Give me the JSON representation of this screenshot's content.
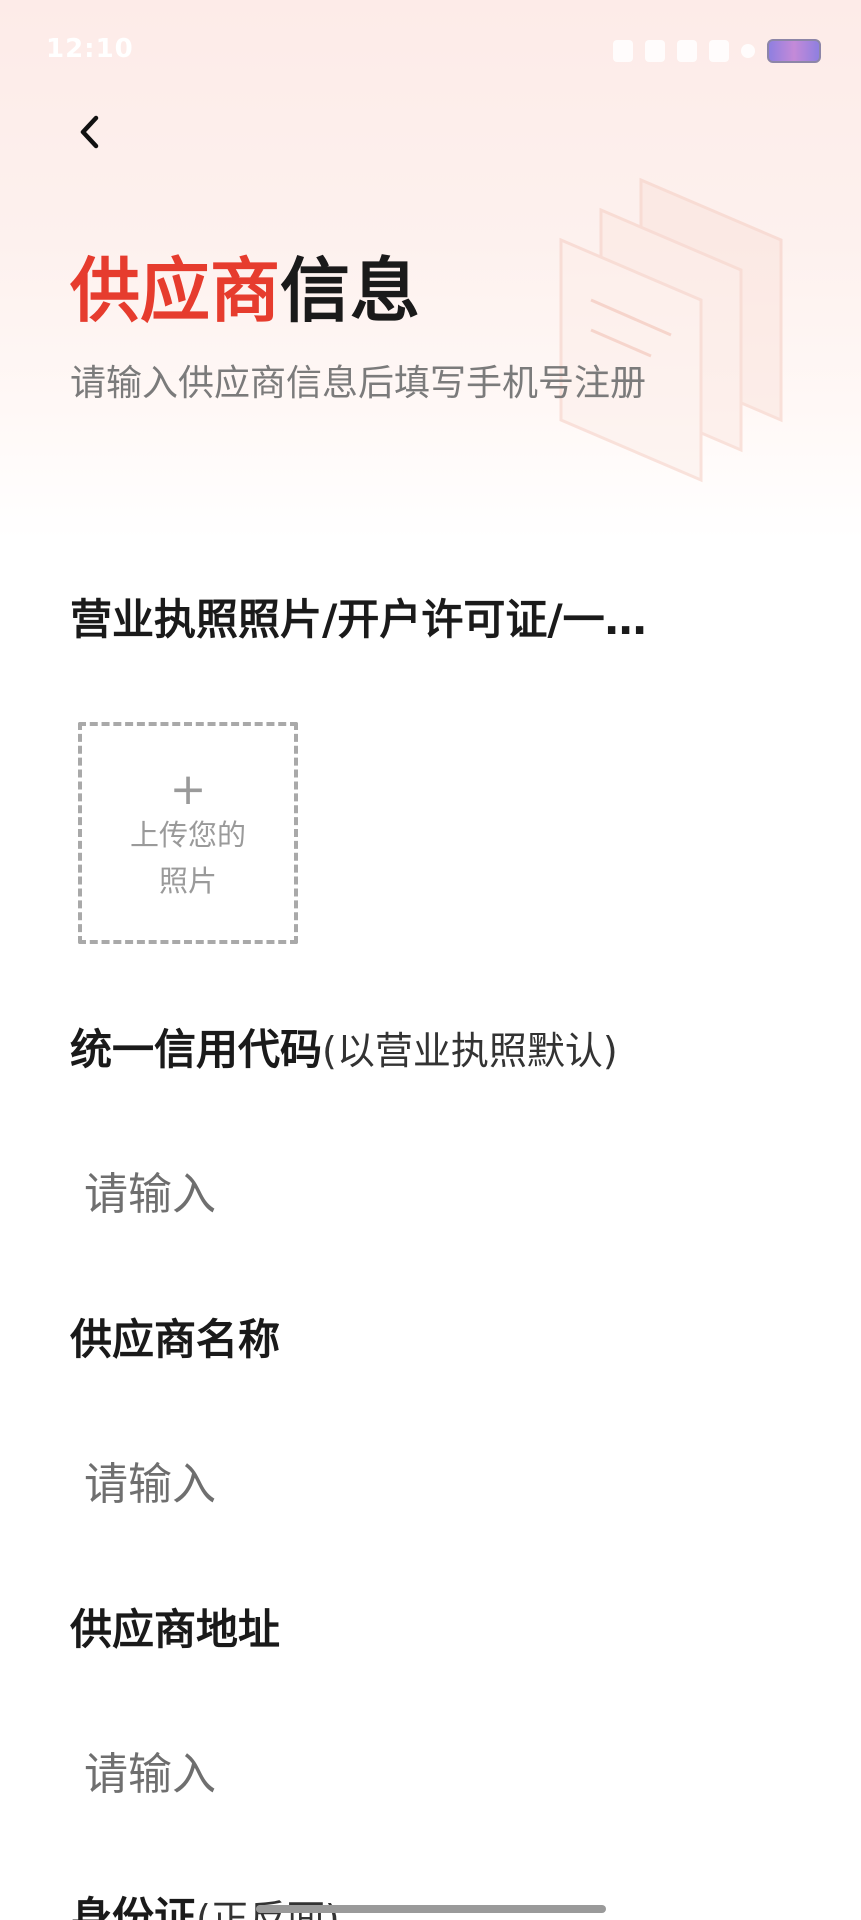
{
  "status_bar": {
    "time": "12:10"
  },
  "header": {
    "title_accent": "供应商",
    "title_rest": "信息",
    "subtitle": "请输入供应商信息后填写手机号注册"
  },
  "form": {
    "license": {
      "label": "营业执照照片/开户许可证/一…",
      "upload_plus": "+",
      "upload_text": "上传您的照片"
    },
    "credit_code": {
      "label": "统一信用代码",
      "note": "(以营业执照默认)",
      "placeholder": "请输入",
      "value": ""
    },
    "supplier_name": {
      "label": "供应商名称",
      "placeholder": "请输入",
      "value": ""
    },
    "supplier_address": {
      "label": "供应商地址",
      "placeholder": "请输入",
      "value": ""
    },
    "id_card": {
      "label": "身份证",
      "note": "(正反面)"
    }
  },
  "colors": {
    "accent": "#e63c2e",
    "header_bg": "#fdebe8"
  }
}
